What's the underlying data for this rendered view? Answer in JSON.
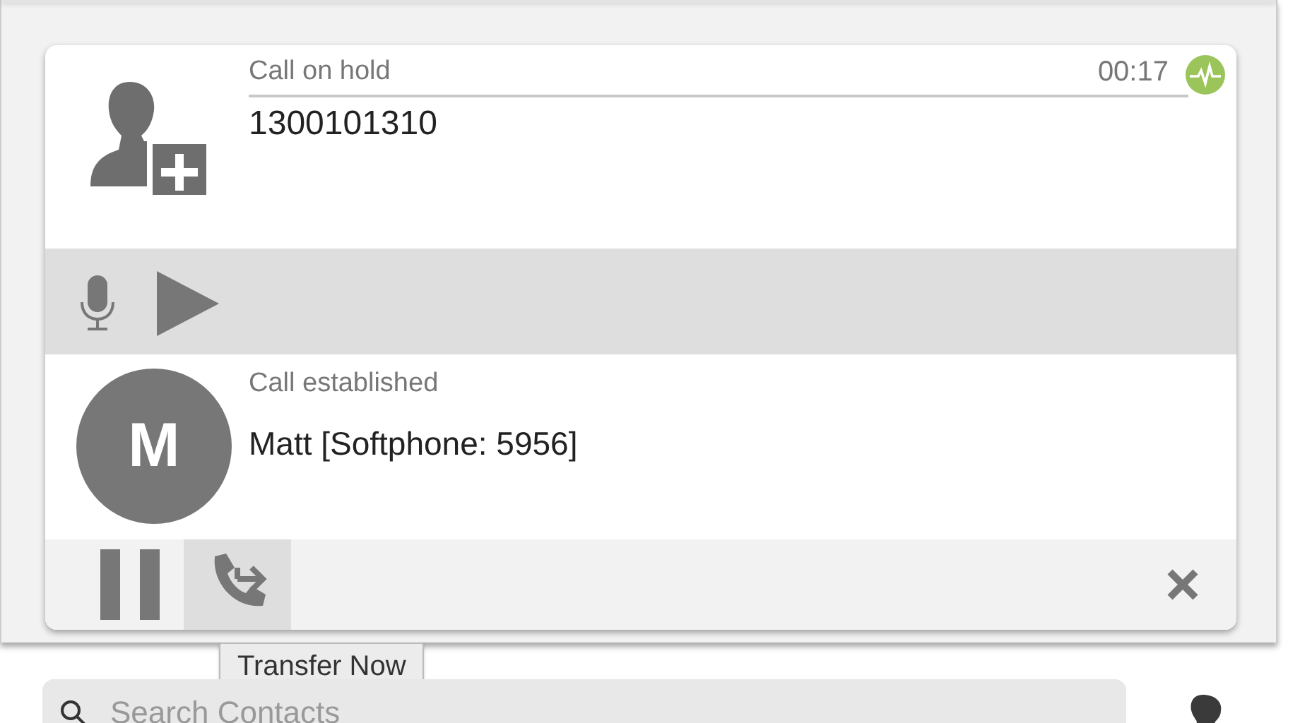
{
  "held_call": {
    "status": "Call on hold",
    "timer": "00:17",
    "number": "1300101310",
    "controls": [
      {
        "kind": "mic"
      },
      {
        "kind": "resume"
      }
    ]
  },
  "active_call": {
    "status": "Call established",
    "avatar_letter": "M",
    "name": "Matt [Softphone: 5956]",
    "controls": [
      {
        "kind": "hold",
        "hovered": false
      },
      {
        "kind": "transfer",
        "hovered": true
      }
    ],
    "tooltip": "Transfer Now"
  },
  "search": {
    "placeholder": "Search Contacts"
  }
}
